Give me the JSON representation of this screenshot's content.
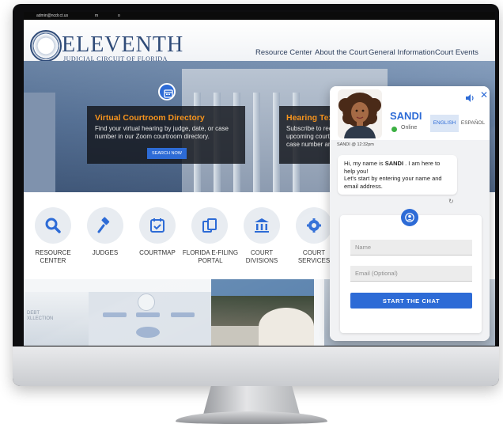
{
  "os_bar": {
    "text_1": "admin@ncdr.ct.us",
    "text_2": "m",
    "text_3": "o"
  },
  "header": {
    "logo_main": "ELEVENTH",
    "logo_sub": "JUDICIAL CIRCUIT OF FLORIDA",
    "nav": [
      "Resource Center",
      "About the Court",
      "General Information",
      "Court Events"
    ]
  },
  "hero": {
    "virtual": {
      "title": "Virtual Courtroom Directory",
      "description": "Find your virtual hearing by judge, date, or case number in our Zoom courtroom directory.",
      "button": "SEARCH NOW"
    },
    "hearing": {
      "title": "Hearing Text",
      "description_1": "Subscribe to rec",
      "description_2": "upcoming court",
      "description_3": "case number an"
    }
  },
  "services": [
    {
      "label": "RESOURCE CENTER",
      "icon": "search-icon"
    },
    {
      "label": "JUDGES",
      "icon": "gavel-icon"
    },
    {
      "label": "COURTMAP",
      "icon": "calendar-check-icon"
    },
    {
      "label": "FLORIDA E-FILING PORTAL",
      "icon": "documents-icon"
    },
    {
      "label": "COURT DIVISIONS",
      "icon": "courthouse-icon"
    },
    {
      "label": "COURT SERVICES",
      "icon": "gear-icon"
    }
  ],
  "bottom": {
    "debt_line1": "DEBT",
    "debt_line2": "XLLECTION"
  },
  "chat": {
    "agent_name": "SANDI",
    "status": "Online",
    "lang_english": "ENGLISH",
    "lang_spanish": "ESPAÑOL",
    "timestamp": "SANDI @ 12:32pm",
    "greeting_pre": "Hi, my name is ",
    "greeting_name": "SANDI",
    "greeting_post": " . I am here to help you!",
    "greeting_line2": "Let's start by entering your name and email address.",
    "name_placeholder": "Name",
    "email_placeholder": "Email (Optional)",
    "start_button": "START THE CHAT",
    "accent_color": "#2d6bd6"
  }
}
